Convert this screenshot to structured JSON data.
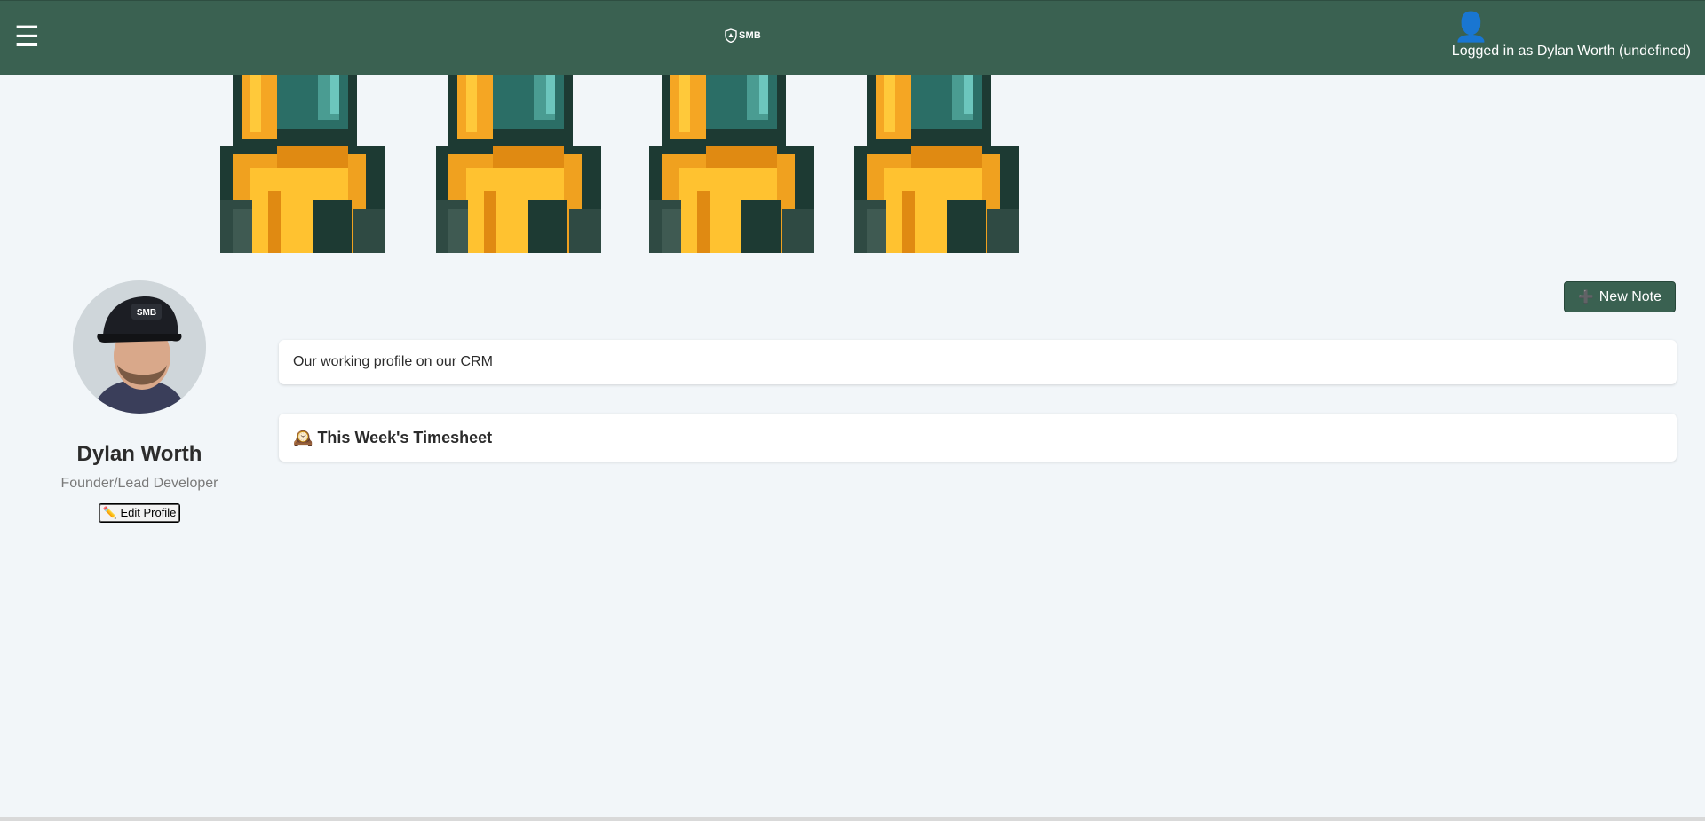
{
  "topbar": {
    "menu_icon": "hamburger-icon",
    "menu_glyph": "☰",
    "logo_text": "SMB",
    "user_icon": "user-icon",
    "user_glyph": "👤",
    "user_label": "Logged in as Dylan Worth (undefined)",
    "bg_color": "#3a6151"
  },
  "banner": {
    "description": "pixel-art-sprites",
    "count": 4
  },
  "profile": {
    "name": "Dylan Worth",
    "role": "Founder/Lead Developer",
    "edit_label": "✏️ Edit Profile",
    "cap_text": "SMB"
  },
  "actions": {
    "new_note_icon": "plus-icon",
    "new_note_glyph": "➕",
    "new_note_label": "New Note"
  },
  "notes": {
    "first_note": "Our working profile on our CRM"
  },
  "timesheet": {
    "icon": "clock-icon",
    "glyph": "🕰️",
    "title": "This Week's Timesheet"
  }
}
